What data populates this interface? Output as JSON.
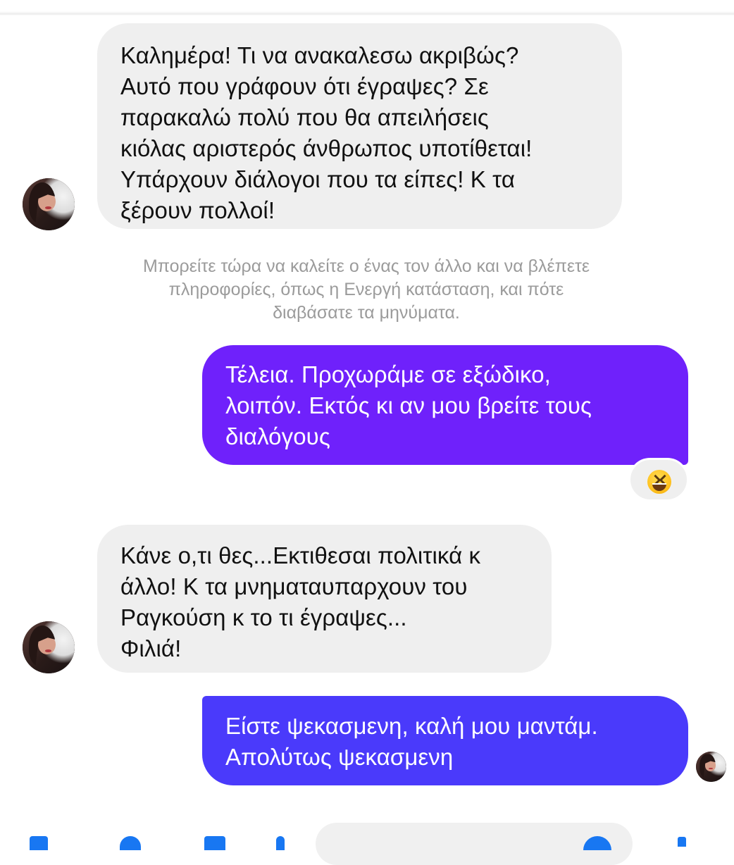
{
  "chat": {
    "messages": [
      {
        "sender": "incoming",
        "text": "Καλημέρα! Τι να ανακαλεσω ακριβώς?\nΑυτό που γράφουν ότι έγραψες? Σε\nπαρακαλώ πολύ που θα απειλήσεις\nκιόλας αριστερός άνθρωπος υποτίθεται!\nΥπάρχουν διάλογοι που τα είπες! Κ τα\nξέρουν πολλοί!"
      },
      {
        "sender": "outgoing",
        "text": "Τέλεια. Προχωράμε σε εξώδικο,\nλοιπόν. Εκτός κι αν μου βρείτε τους\nδιαλόγους",
        "color": "#6f21fb",
        "reaction": "grinning-squinting-face"
      },
      {
        "sender": "incoming",
        "text": "Κάνε ο,τι θες...Εκτιθεσαι πολιτικά κ\nάλλο! Κ τα μνηματαυπαρχουν του\nΡαγκούση κ το τι έγραψες...\nΦιλιά!"
      },
      {
        "sender": "outgoing",
        "text": "Είστε ψεκασμενη, καλή μου μαντάμ.\nΑπολύτως ψεκασμενη",
        "color": "#4a3afb"
      }
    ],
    "notice": "Μπορείτε τώρα να καλείτε ο ένας τον άλλο και να βλέπετε\nπληροφορίες, όπως η Ενεργή κατάσταση, και πότε\nδιαβάσατε τα μηνύματα."
  },
  "colors": {
    "incoming_bubble": "#efefef",
    "notice_text": "#9b9b9b",
    "accent": "#1877f2"
  }
}
